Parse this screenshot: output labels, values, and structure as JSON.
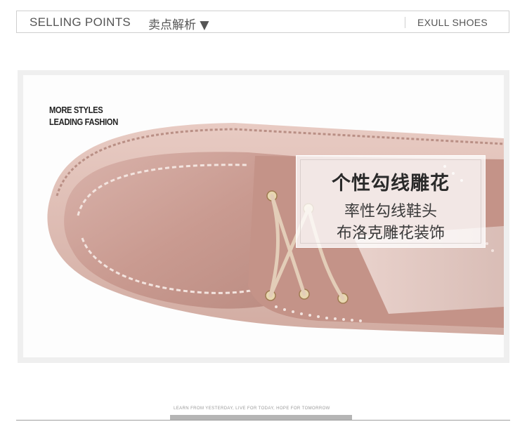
{
  "header": {
    "title": "SELLING POINTS",
    "subtitle": "卖点解析 ▼",
    "brand": "EXULL SHOES"
  },
  "photo": {
    "tagline": [
      "MORE STYLES",
      "LEADING FASHION"
    ],
    "feature": {
      "title": "个性勾线雕花",
      "lines": [
        "率性勾线鞋头",
        "布洛克雕花装饰"
      ]
    }
  },
  "footer": {
    "motto": "LEARN FROM YESTERDAY, LIVE FOR TODAY, HOPE FOR TOMORROW"
  }
}
